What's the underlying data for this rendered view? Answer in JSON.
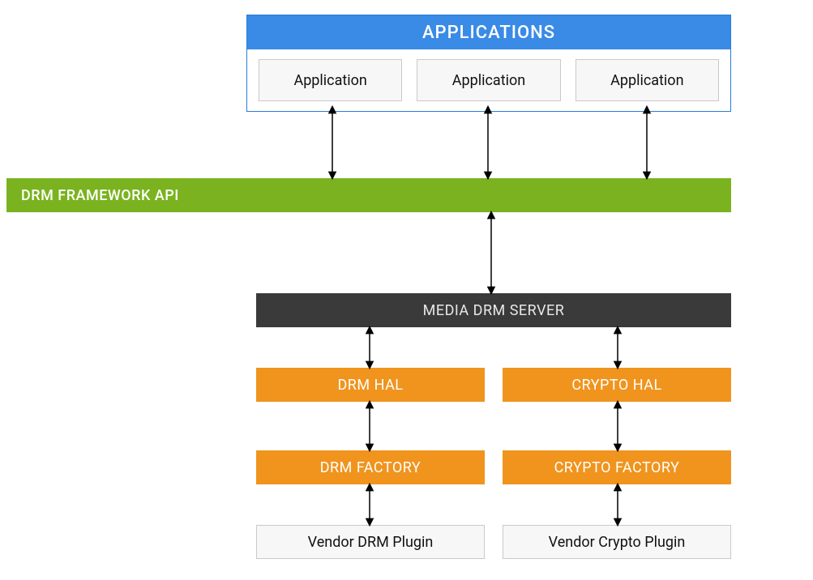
{
  "applications": {
    "title": "APPLICATIONS",
    "items": [
      "Application",
      "Application",
      "Application"
    ]
  },
  "framework": {
    "title": "DRM FRAMEWORK API"
  },
  "mediaserver": {
    "title": "MEDIA DRM SERVER"
  },
  "hal": {
    "drm": "DRM HAL",
    "crypto": "CRYPTO HAL"
  },
  "factory": {
    "drm": "DRM FACTORY",
    "crypto": "CRYPTO FACTORY"
  },
  "plugin": {
    "drm": "Vendor DRM Plugin",
    "crypto": "Vendor Crypto Plugin"
  }
}
